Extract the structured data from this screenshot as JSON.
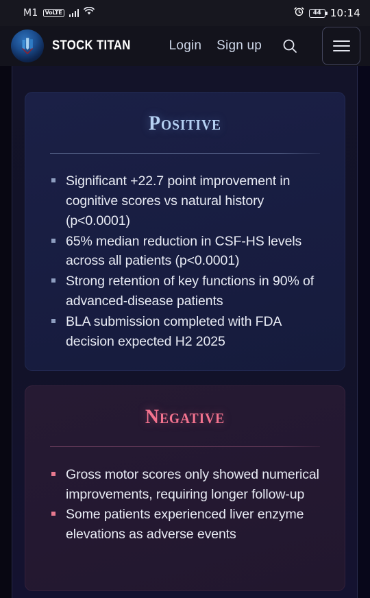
{
  "statusbar": {
    "carrier": "M1",
    "volte_badge": "VoLTE",
    "signal_icon": "signal-bars-icon",
    "wifi_icon": "wifi-icon",
    "alarm_icon": "alarm-clock-icon",
    "battery_level": "44",
    "time": "10:14"
  },
  "navbar": {
    "brand_name": "STOCK TITAN",
    "logo_icon": "stock-titan-logo-icon",
    "login_label": "Login",
    "signup_label": "Sign up",
    "search_icon": "search-icon",
    "menu_icon": "hamburger-menu-icon"
  },
  "cards": {
    "positive": {
      "title": "Positive",
      "accent_color": "#b6d2f4",
      "bullets": [
        "Significant +22.7 point improvement in cognitive scores vs natural history (p<0.0001)",
        "65% median reduction in CSF-HS levels across all patients (p<0.0001)",
        "Strong retention of key functions in 90% of advanced-disease patients",
        "BLA submission completed with FDA decision expected H2 2025"
      ]
    },
    "negative": {
      "title": "Negative",
      "accent_color": "#f4738f",
      "bullets": [
        "Gross motor scores only showed numerical improvements, requiring longer follow-up",
        "Some patients experienced liver enzyme elevations as adverse events"
      ]
    }
  }
}
